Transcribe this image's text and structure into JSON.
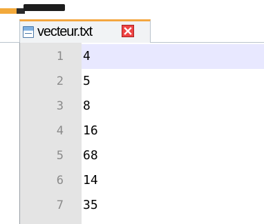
{
  "tab": {
    "filename": "vecteur.txt",
    "file_icon": "file-icon",
    "close_icon": "close-icon",
    "active_accent": "#f3a63f",
    "close_color": "#e44444"
  },
  "editor": {
    "current_line_color": "#e8e8ff",
    "gutter_color": "#e4e4e4",
    "lines": [
      {
        "number": "1",
        "text": "4"
      },
      {
        "number": "2",
        "text": "5"
      },
      {
        "number": "3",
        "text": "8"
      },
      {
        "number": "4",
        "text": "16"
      },
      {
        "number": "5",
        "text": "68"
      },
      {
        "number": "6",
        "text": "14"
      },
      {
        "number": "7",
        "text": "35"
      }
    ]
  }
}
